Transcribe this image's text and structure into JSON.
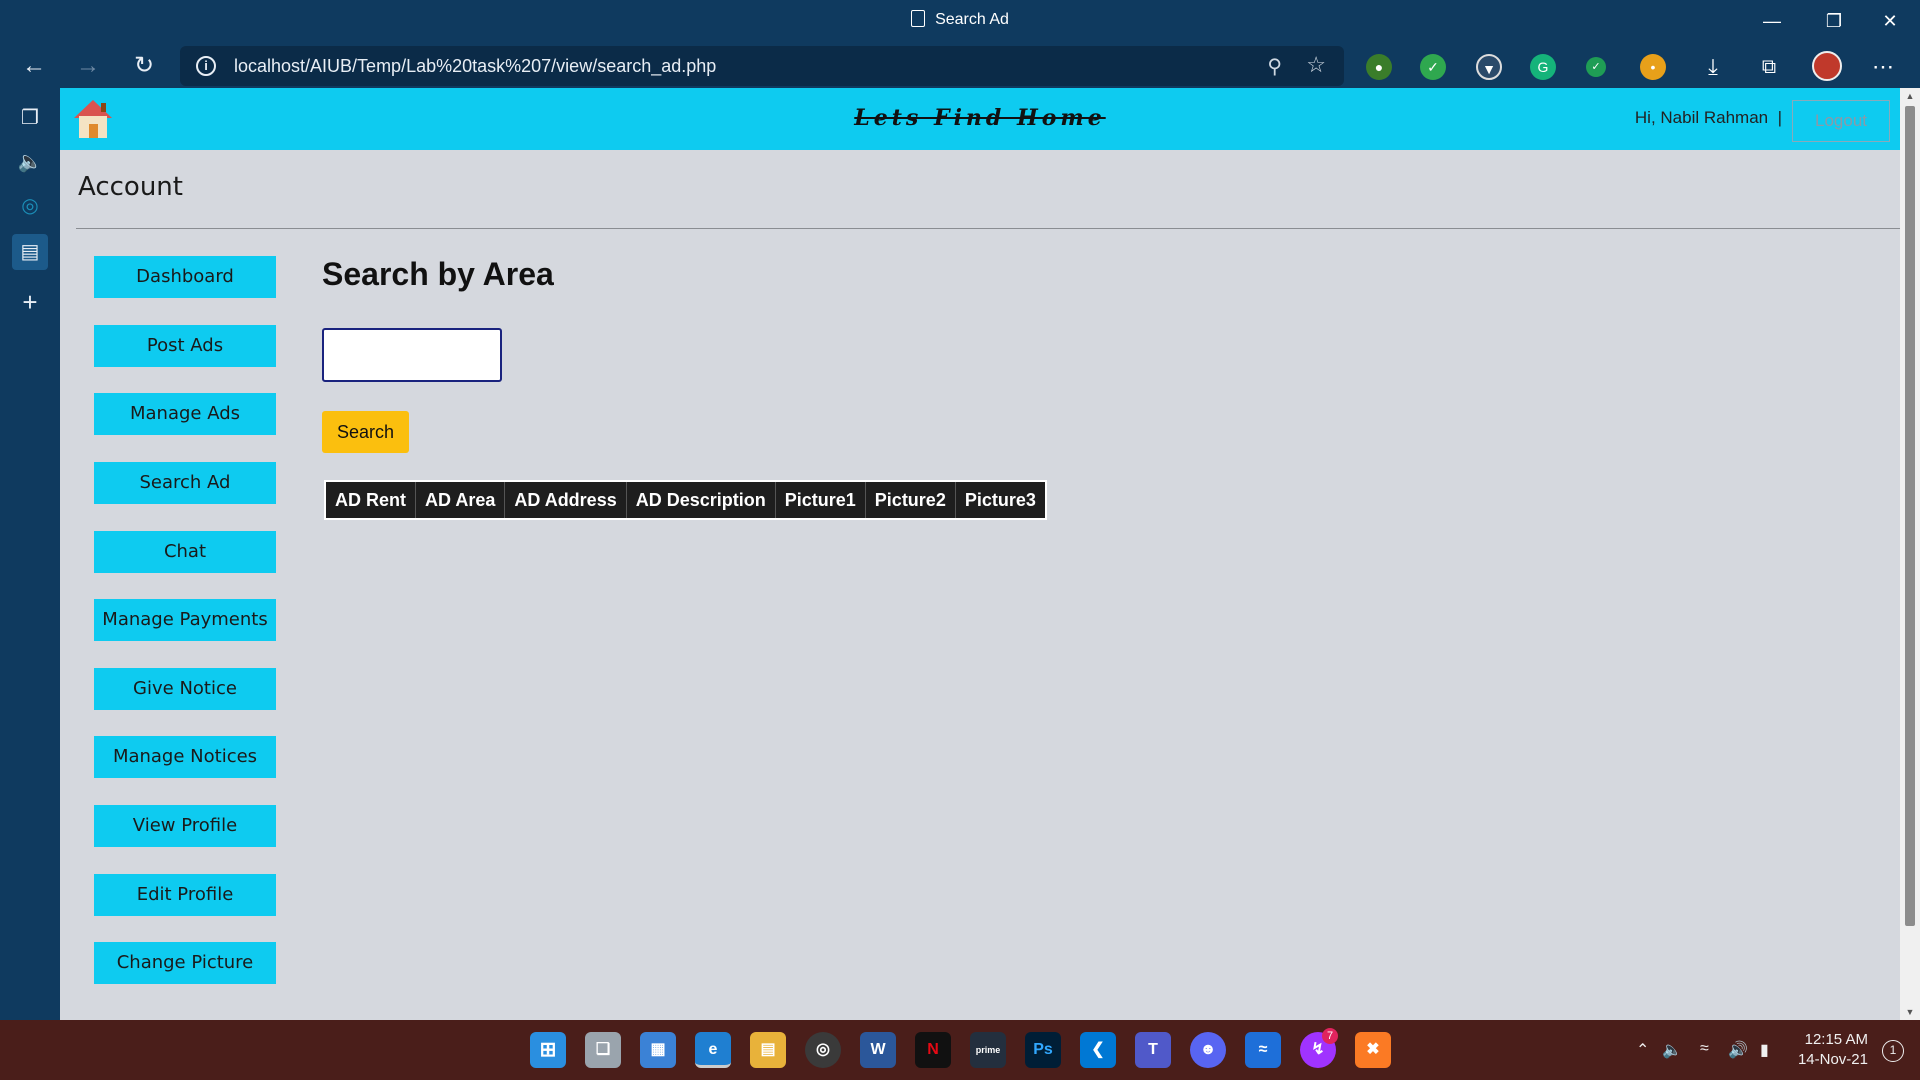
{
  "window": {
    "title": "Search Ad"
  },
  "browser": {
    "url": "localhost/AIUB/Temp/Lab%20task%207/view/search_ad.php"
  },
  "site": {
    "brand": "Lets Find Home",
    "greeting": "Hi, Nabil Rahman",
    "separator": "|",
    "logout_label": "Logout"
  },
  "page": {
    "account_title": "Account",
    "heading": "Search by Area",
    "search_value": "",
    "search_button": "Search"
  },
  "menu": [
    {
      "label": "Dashboard"
    },
    {
      "label": "Post Ads"
    },
    {
      "label": "Manage Ads"
    },
    {
      "label": "Search Ad"
    },
    {
      "label": "Chat"
    },
    {
      "label": "Manage Payments"
    },
    {
      "label": "Give Notice"
    },
    {
      "label": "Manage Notices"
    },
    {
      "label": "View Profile"
    },
    {
      "label": "Edit Profile"
    },
    {
      "label": "Change Picture"
    }
  ],
  "table": {
    "headers": [
      "AD Rent",
      "AD Area",
      "AD Address",
      "AD Description",
      "Picture1",
      "Picture2",
      "Picture3"
    ]
  },
  "taskbar": {
    "time": "12:15 AM",
    "date": "14-Nov-21",
    "messenger_badge": "7",
    "notification_count": "1"
  },
  "colors": {
    "header_bg": "#0ecbf0",
    "menu_button_bg": "#0ecbf0",
    "search_button_bg": "#fbbf0e",
    "page_bg": "#d5d8de",
    "chrome_bg": "#0f3a5f"
  }
}
